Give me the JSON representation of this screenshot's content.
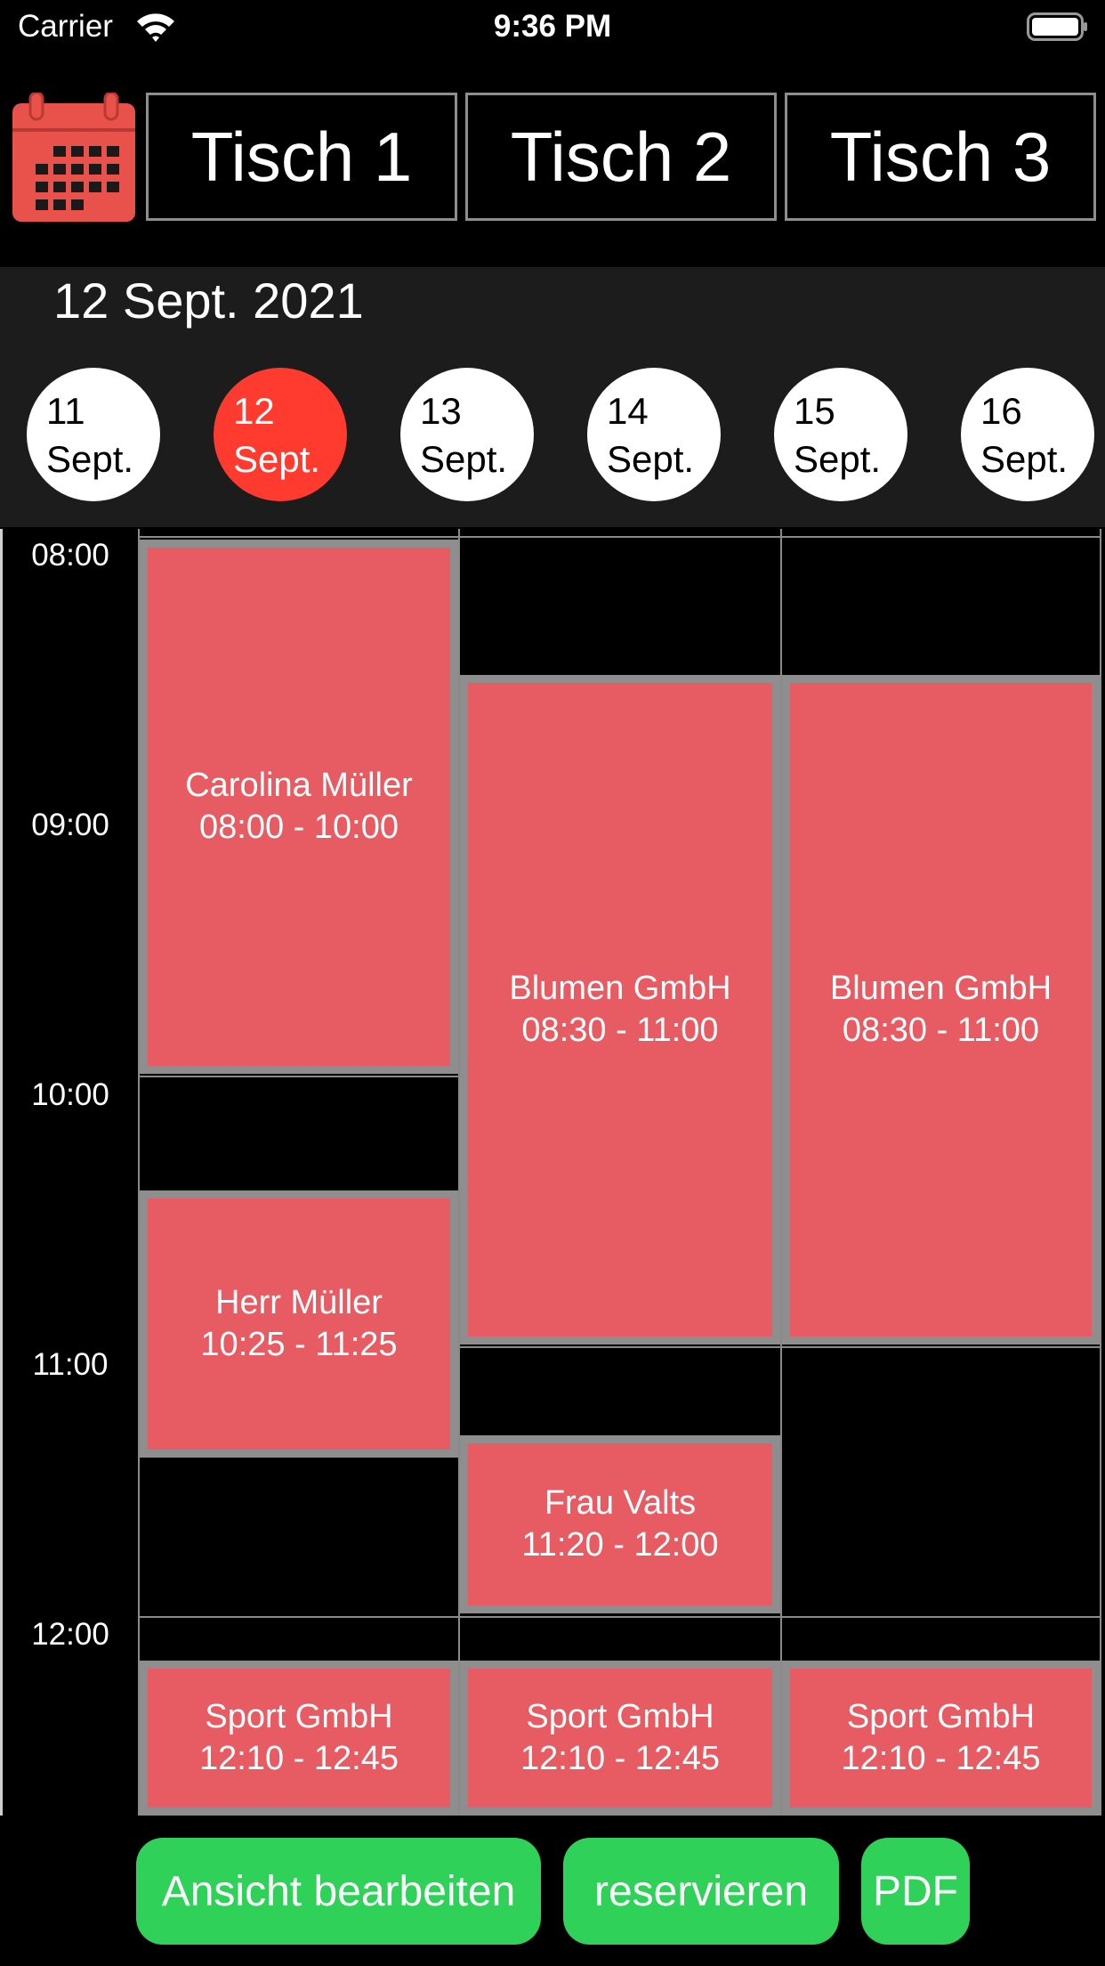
{
  "status_bar": {
    "carrier": "Carrier",
    "time": "9:36 PM"
  },
  "tables": [
    "Tisch 1",
    "Tisch 2",
    "Tisch 3"
  ],
  "selected_date": "12 Sept. 2021",
  "days": [
    {
      "day": "11",
      "month": "Sept.",
      "selected": false
    },
    {
      "day": "12",
      "month": "Sept.",
      "selected": true
    },
    {
      "day": "13",
      "month": "Sept.",
      "selected": false
    },
    {
      "day": "14",
      "month": "Sept.",
      "selected": false
    },
    {
      "day": "15",
      "month": "Sept.",
      "selected": false
    },
    {
      "day": "16",
      "month": "Sept.",
      "selected": false
    }
  ],
  "hours": [
    "08:00",
    "09:00",
    "10:00",
    "11:00",
    "12:00"
  ],
  "reservations": [
    {
      "name": "Carolina Müller",
      "time": "08:00 - 10:00"
    },
    {
      "name": "Blumen GmbH",
      "time": "08:30 - 11:00"
    },
    {
      "name": "Blumen GmbH",
      "time": "08:30 - 11:00"
    },
    {
      "name": "Herr Müller",
      "time": "10:25 - 11:25"
    },
    {
      "name": "Frau Valts",
      "time": "11:20 - 12:00"
    },
    {
      "name": "Sport GmbH",
      "time": "12:10 - 12:45"
    },
    {
      "name": "Sport GmbH",
      "time": "12:10 - 12:45"
    },
    {
      "name": "Sport GmbH",
      "time": "12:10 - 12:45"
    }
  ],
  "buttons": {
    "edit_view": "Ansicht bearbeiten",
    "reserve": "reservieren",
    "pdf": "PDF"
  },
  "colors": {
    "event": "#e65c62",
    "selected_day": "#ff3b30",
    "button": "#30d158",
    "calendar_icon": "#e8524a"
  },
  "icons": {
    "calendar": "calendar-icon",
    "wifi": "wifi-icon",
    "battery": "battery-icon"
  }
}
